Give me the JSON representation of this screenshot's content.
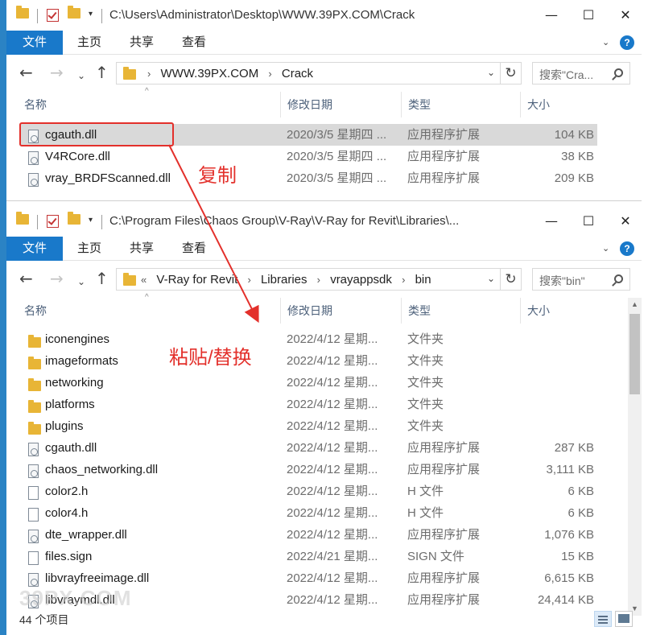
{
  "top_window": {
    "title": "C:\\Users\\Administrator\\Desktop\\WWW.39PX.COM\\Crack",
    "ribbon_tabs": [
      "文件",
      "主页",
      "共享",
      "查看"
    ],
    "breadcrumb": [
      "WWW.39PX.COM",
      "Crack"
    ],
    "search_placeholder": "搜索\"Cra...",
    "columns": [
      "名称",
      "修改日期",
      "类型",
      "大小"
    ],
    "files": [
      {
        "name": "cgauth.dll",
        "date": "2020/3/5 星期四 ...",
        "type": "应用程序扩展",
        "size": "104 KB",
        "icon": "dll-icon",
        "selected": true
      },
      {
        "name": "V4RCore.dll",
        "date": "2020/3/5 星期四 ...",
        "type": "应用程序扩展",
        "size": "38 KB",
        "icon": "dll-icon"
      },
      {
        "name": "vray_BRDFScanned.dll",
        "date": "2020/3/5 星期四 ...",
        "type": "应用程序扩展",
        "size": "209 KB",
        "icon": "dll-icon"
      }
    ]
  },
  "bottom_window": {
    "title": "C:\\Program Files\\Chaos Group\\V-Ray\\V-Ray for Revit\\Libraries\\...",
    "ribbon_tabs": [
      "文件",
      "主页",
      "共享",
      "查看"
    ],
    "breadcrumb_prefix": "«",
    "breadcrumb": [
      "V-Ray for Revit",
      "Libraries",
      "vrayappsdk",
      "bin"
    ],
    "search_placeholder": "搜索\"bin\"",
    "columns": [
      "名称",
      "修改日期",
      "类型",
      "大小"
    ],
    "files": [
      {
        "name": "iconengines",
        "date": "2022/4/12 星期...",
        "type": "文件夹",
        "size": "",
        "icon": "folder-icon"
      },
      {
        "name": "imageformats",
        "date": "2022/4/12 星期...",
        "type": "文件夹",
        "size": "",
        "icon": "folder-icon"
      },
      {
        "name": "networking",
        "date": "2022/4/12 星期...",
        "type": "文件夹",
        "size": "",
        "icon": "folder-icon"
      },
      {
        "name": "platforms",
        "date": "2022/4/12 星期...",
        "type": "文件夹",
        "size": "",
        "icon": "folder-icon"
      },
      {
        "name": "plugins",
        "date": "2022/4/12 星期...",
        "type": "文件夹",
        "size": "",
        "icon": "folder-icon"
      },
      {
        "name": "cgauth.dll",
        "date": "2022/4/12 星期...",
        "type": "应用程序扩展",
        "size": "287 KB",
        "icon": "dll-icon"
      },
      {
        "name": "chaos_networking.dll",
        "date": "2022/4/12 星期...",
        "type": "应用程序扩展",
        "size": "3,111 KB",
        "icon": "dll-icon"
      },
      {
        "name": "color2.h",
        "date": "2022/4/12 星期...",
        "type": "H 文件",
        "size": "6 KB",
        "icon": "file-icon"
      },
      {
        "name": "color4.h",
        "date": "2022/4/12 星期...",
        "type": "H 文件",
        "size": "6 KB",
        "icon": "file-icon"
      },
      {
        "name": "dte_wrapper.dll",
        "date": "2022/4/12 星期...",
        "type": "应用程序扩展",
        "size": "1,076 KB",
        "icon": "dll-icon"
      },
      {
        "name": "files.sign",
        "date": "2022/4/21 星期...",
        "type": "SIGN 文件",
        "size": "15 KB",
        "icon": "file-icon"
      },
      {
        "name": "libvrayfreeimage.dll",
        "date": "2022/4/12 星期...",
        "type": "应用程序扩展",
        "size": "6,615 KB",
        "icon": "dll-icon"
      },
      {
        "name": "libvraymdl.dll",
        "date": "2022/4/12 星期...",
        "type": "应用程序扩展",
        "size": "24,414 KB",
        "icon": "dll-icon"
      }
    ],
    "status_count": "44 个项目"
  },
  "annotations": {
    "copy_label": "复制",
    "paste_label": "粘贴/替换",
    "color": "#e3302b"
  },
  "watermark": "39PX.COM",
  "colors": {
    "file_tab": "#1979ca",
    "selection": "#d9d9d9",
    "folder": "#e8b536"
  }
}
